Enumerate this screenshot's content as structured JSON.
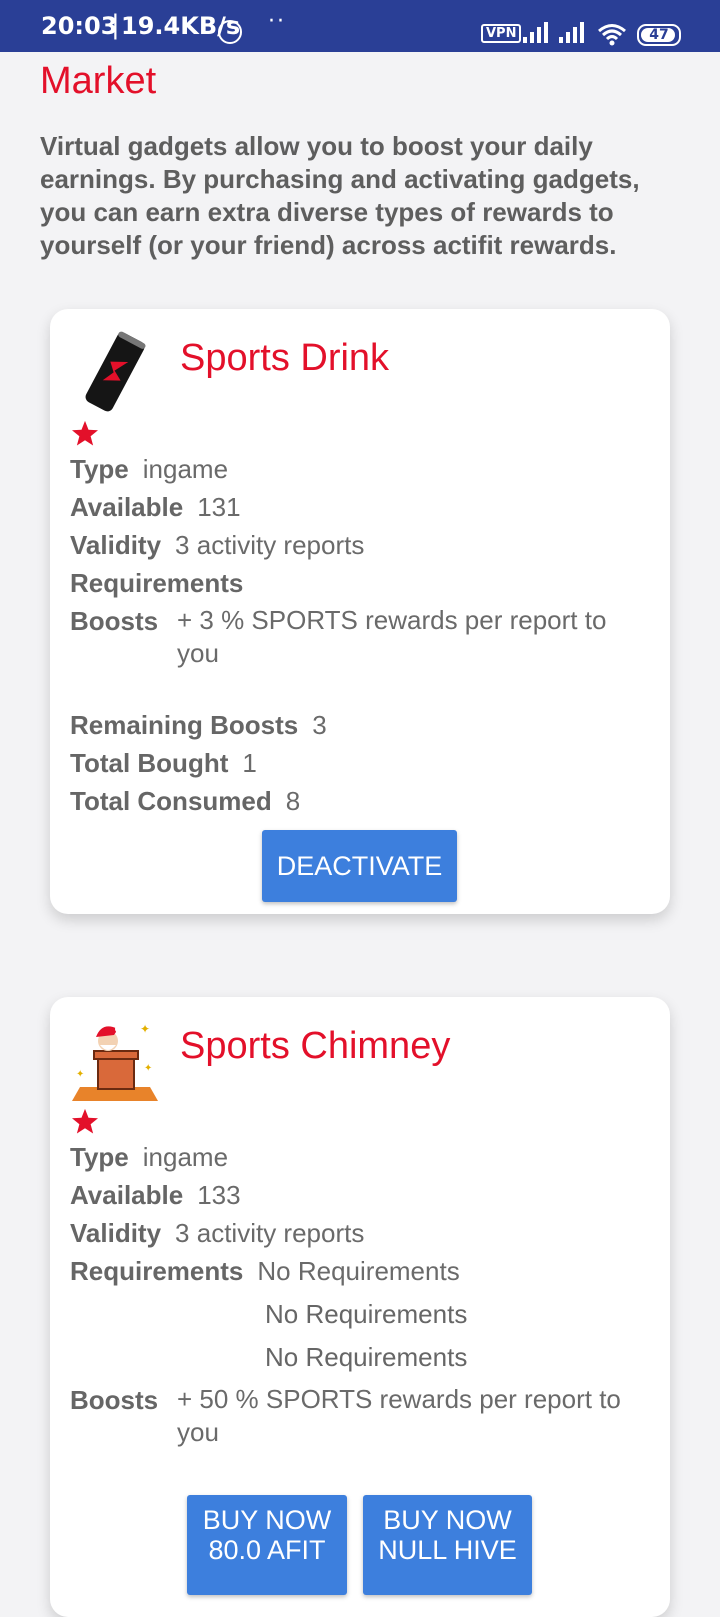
{
  "status_bar": {
    "time": "20:03",
    "separator": "|",
    "speed": "19.4KB/s",
    "dots": "··",
    "vpn": "VPN",
    "battery": "47"
  },
  "page": {
    "title": "Market",
    "intro": "Virtual gadgets allow you to boost your daily earnings. By purchasing and activating gadgets, you can earn extra diverse types of rewards to yourself (or your friend) across actifit rewards."
  },
  "labels": {
    "type": "Type",
    "available": "Available",
    "validity": "Validity",
    "requirements": "Requirements",
    "boosts": "Boosts",
    "remaining": "Remaining Boosts",
    "bought": "Total Bought",
    "consumed": "Total Consumed"
  },
  "gadgets": [
    {
      "name": "Sports Drink",
      "icon": "energy-drink-can-icon",
      "type": "ingame",
      "available": "131",
      "validity": "3 activity reports",
      "boost": "+ 3 % SPORTS rewards per report to you",
      "remaining": "3",
      "bought": "1",
      "consumed": "8",
      "action": "DEACTIVATE"
    },
    {
      "name": "Sports Chimney",
      "icon": "santa-chimney-icon",
      "type": "ingame",
      "available": "133",
      "validity": "3 activity reports",
      "requirements": [
        "No Requirements",
        "No Requirements",
        "No Requirements"
      ],
      "boost": "+ 50 % SPORTS rewards per report to you",
      "buy_afit": "BUY NOW 80.0 AFIT",
      "buy_hive": "BUY NOW NULL HIVE"
    }
  ],
  "colors": {
    "accent_red": "#e3102a",
    "button_blue": "#3d7fdd",
    "status_bar": "#2a3f96"
  }
}
